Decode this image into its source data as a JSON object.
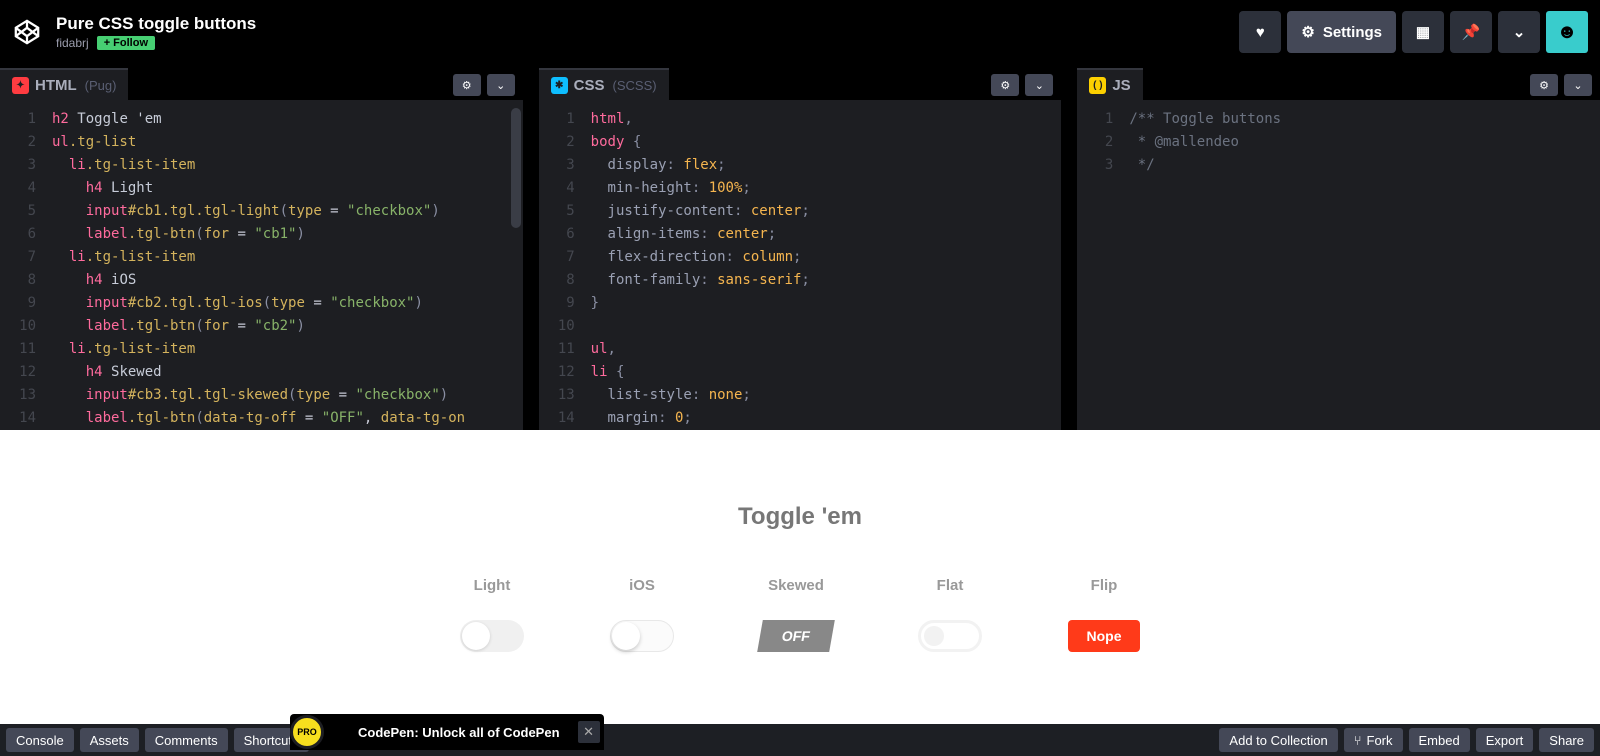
{
  "header": {
    "title": "Pure CSS toggle buttons",
    "author": "fidabrj",
    "follow": "+ Follow",
    "settings": "Settings"
  },
  "panes": {
    "html": {
      "name": "HTML",
      "sub": "(Pug)"
    },
    "css": {
      "name": "CSS",
      "sub": "(SCSS)"
    },
    "js": {
      "name": "JS",
      "sub": ""
    }
  },
  "html_lines": [
    {
      "n": 1,
      "html": "<span class='tok-tag'>h2</span> <span class='tok-plain'>Toggle 'em</span>"
    },
    {
      "n": 2,
      "html": "<span class='tok-tag'>ul</span><span class='tok-cls'>.tg-list</span>"
    },
    {
      "n": 3,
      "html": "  <span class='tok-tag'>li</span><span class='tok-cls'>.tg-list-item</span>"
    },
    {
      "n": 4,
      "html": "    <span class='tok-tag'>h4</span> <span class='tok-plain'>Light</span>"
    },
    {
      "n": 5,
      "html": "    <span class='tok-tag'>input</span><span class='tok-cls'>#cb1.tgl.tgl-light</span><span class='tok-punc'>(</span><span class='tok-attr'>type</span> = <span class='tok-str'>\"checkbox\"</span><span class='tok-punc'>)</span>"
    },
    {
      "n": 6,
      "html": "    <span class='tok-tag'>label</span><span class='tok-cls'>.tgl-btn</span><span class='tok-punc'>(</span><span class='tok-attr'>for</span> = <span class='tok-str'>\"cb1\"</span><span class='tok-punc'>)</span>"
    },
    {
      "n": 7,
      "html": "  <span class='tok-tag'>li</span><span class='tok-cls'>.tg-list-item</span>"
    },
    {
      "n": 8,
      "html": "    <span class='tok-tag'>h4</span> <span class='tok-plain'>iOS</span>"
    },
    {
      "n": 9,
      "html": "    <span class='tok-tag'>input</span><span class='tok-cls'>#cb2.tgl.tgl-ios</span><span class='tok-punc'>(</span><span class='tok-attr'>type</span> = <span class='tok-str'>\"checkbox\"</span><span class='tok-punc'>)</span>"
    },
    {
      "n": 10,
      "html": "    <span class='tok-tag'>label</span><span class='tok-cls'>.tgl-btn</span><span class='tok-punc'>(</span><span class='tok-attr'>for</span> = <span class='tok-str'>\"cb2\"</span><span class='tok-punc'>)</span>"
    },
    {
      "n": 11,
      "html": "  <span class='tok-tag'>li</span><span class='tok-cls'>.tg-list-item</span>"
    },
    {
      "n": 12,
      "html": "    <span class='tok-tag'>h4</span> <span class='tok-plain'>Skewed</span>"
    },
    {
      "n": 13,
      "html": "    <span class='tok-tag'>input</span><span class='tok-cls'>#cb3.tgl.tgl-skewed</span><span class='tok-punc'>(</span><span class='tok-attr'>type</span> = <span class='tok-str'>\"checkbox\"</span><span class='tok-punc'>)</span>"
    },
    {
      "n": 14,
      "html": "    <span class='tok-tag'>label</span><span class='tok-cls'>.tgl-btn</span><span class='tok-punc'>(</span><span class='tok-attr'>data-tg-off</span> = <span class='tok-str'>\"OFF\"</span>, <span class='tok-attr'>data-tg-on</span>"
    }
  ],
  "css_lines": [
    {
      "n": 1,
      "html": "<span class='tok-tag'>html</span><span class='tok-punc'>,</span>"
    },
    {
      "n": 2,
      "html": "<span class='tok-tag'>body</span> <span class='tok-punc'>{</span>"
    },
    {
      "n": 3,
      "html": "  <span class='tok-prop'>display</span><span class='tok-punc'>:</span> <span class='tok-val'>flex</span><span class='tok-punc'>;</span>"
    },
    {
      "n": 4,
      "html": "  <span class='tok-prop'>min-height</span><span class='tok-punc'>:</span> <span class='tok-val'>100%</span><span class='tok-punc'>;</span>"
    },
    {
      "n": 5,
      "html": "  <span class='tok-prop'>justify-content</span><span class='tok-punc'>:</span> <span class='tok-val'>center</span><span class='tok-punc'>;</span>"
    },
    {
      "n": 6,
      "html": "  <span class='tok-prop'>align-items</span><span class='tok-punc'>:</span> <span class='tok-val'>center</span><span class='tok-punc'>;</span>"
    },
    {
      "n": 7,
      "html": "  <span class='tok-prop'>flex-direction</span><span class='tok-punc'>:</span> <span class='tok-val'>column</span><span class='tok-punc'>;</span>"
    },
    {
      "n": 8,
      "html": "  <span class='tok-prop'>font-family</span><span class='tok-punc'>:</span> <span class='tok-val'>sans-serif</span><span class='tok-punc'>;</span>"
    },
    {
      "n": 9,
      "html": "<span class='tok-punc'>}</span>"
    },
    {
      "n": 10,
      "html": ""
    },
    {
      "n": 11,
      "html": "<span class='tok-tag'>ul</span><span class='tok-punc'>,</span>"
    },
    {
      "n": 12,
      "html": "<span class='tok-tag'>li</span> <span class='tok-punc'>{</span>"
    },
    {
      "n": 13,
      "html": "  <span class='tok-prop'>list-style</span><span class='tok-punc'>:</span> <span class='tok-val'>none</span><span class='tok-punc'>;</span>"
    },
    {
      "n": 14,
      "html": "  <span class='tok-prop'>margin</span><span class='tok-punc'>:</span> <span class='tok-val'>0</span><span class='tok-punc'>;</span>"
    }
  ],
  "js_lines": [
    {
      "n": 1,
      "html": "<span class='tok-com'>/** Toggle buttons</span>"
    },
    {
      "n": 2,
      "html": "<span class='tok-com'> * @mallendeo</span>"
    },
    {
      "n": 3,
      "html": "<span class='tok-com'> */</span>"
    }
  ],
  "preview": {
    "heading": "Toggle 'em",
    "items": [
      "Light",
      "iOS",
      "Skewed",
      "Flat",
      "Flip"
    ],
    "skewed_off": "OFF",
    "flip_off": "Nope"
  },
  "footer": {
    "left": [
      "Console",
      "Assets",
      "Comments",
      "Shortcuts"
    ],
    "right": [
      "Add to Collection",
      "Fork",
      "Embed",
      "Export",
      "Share"
    ]
  },
  "promo": {
    "badge": "PRO",
    "text": "CodePen: Unlock all of CodePen"
  }
}
